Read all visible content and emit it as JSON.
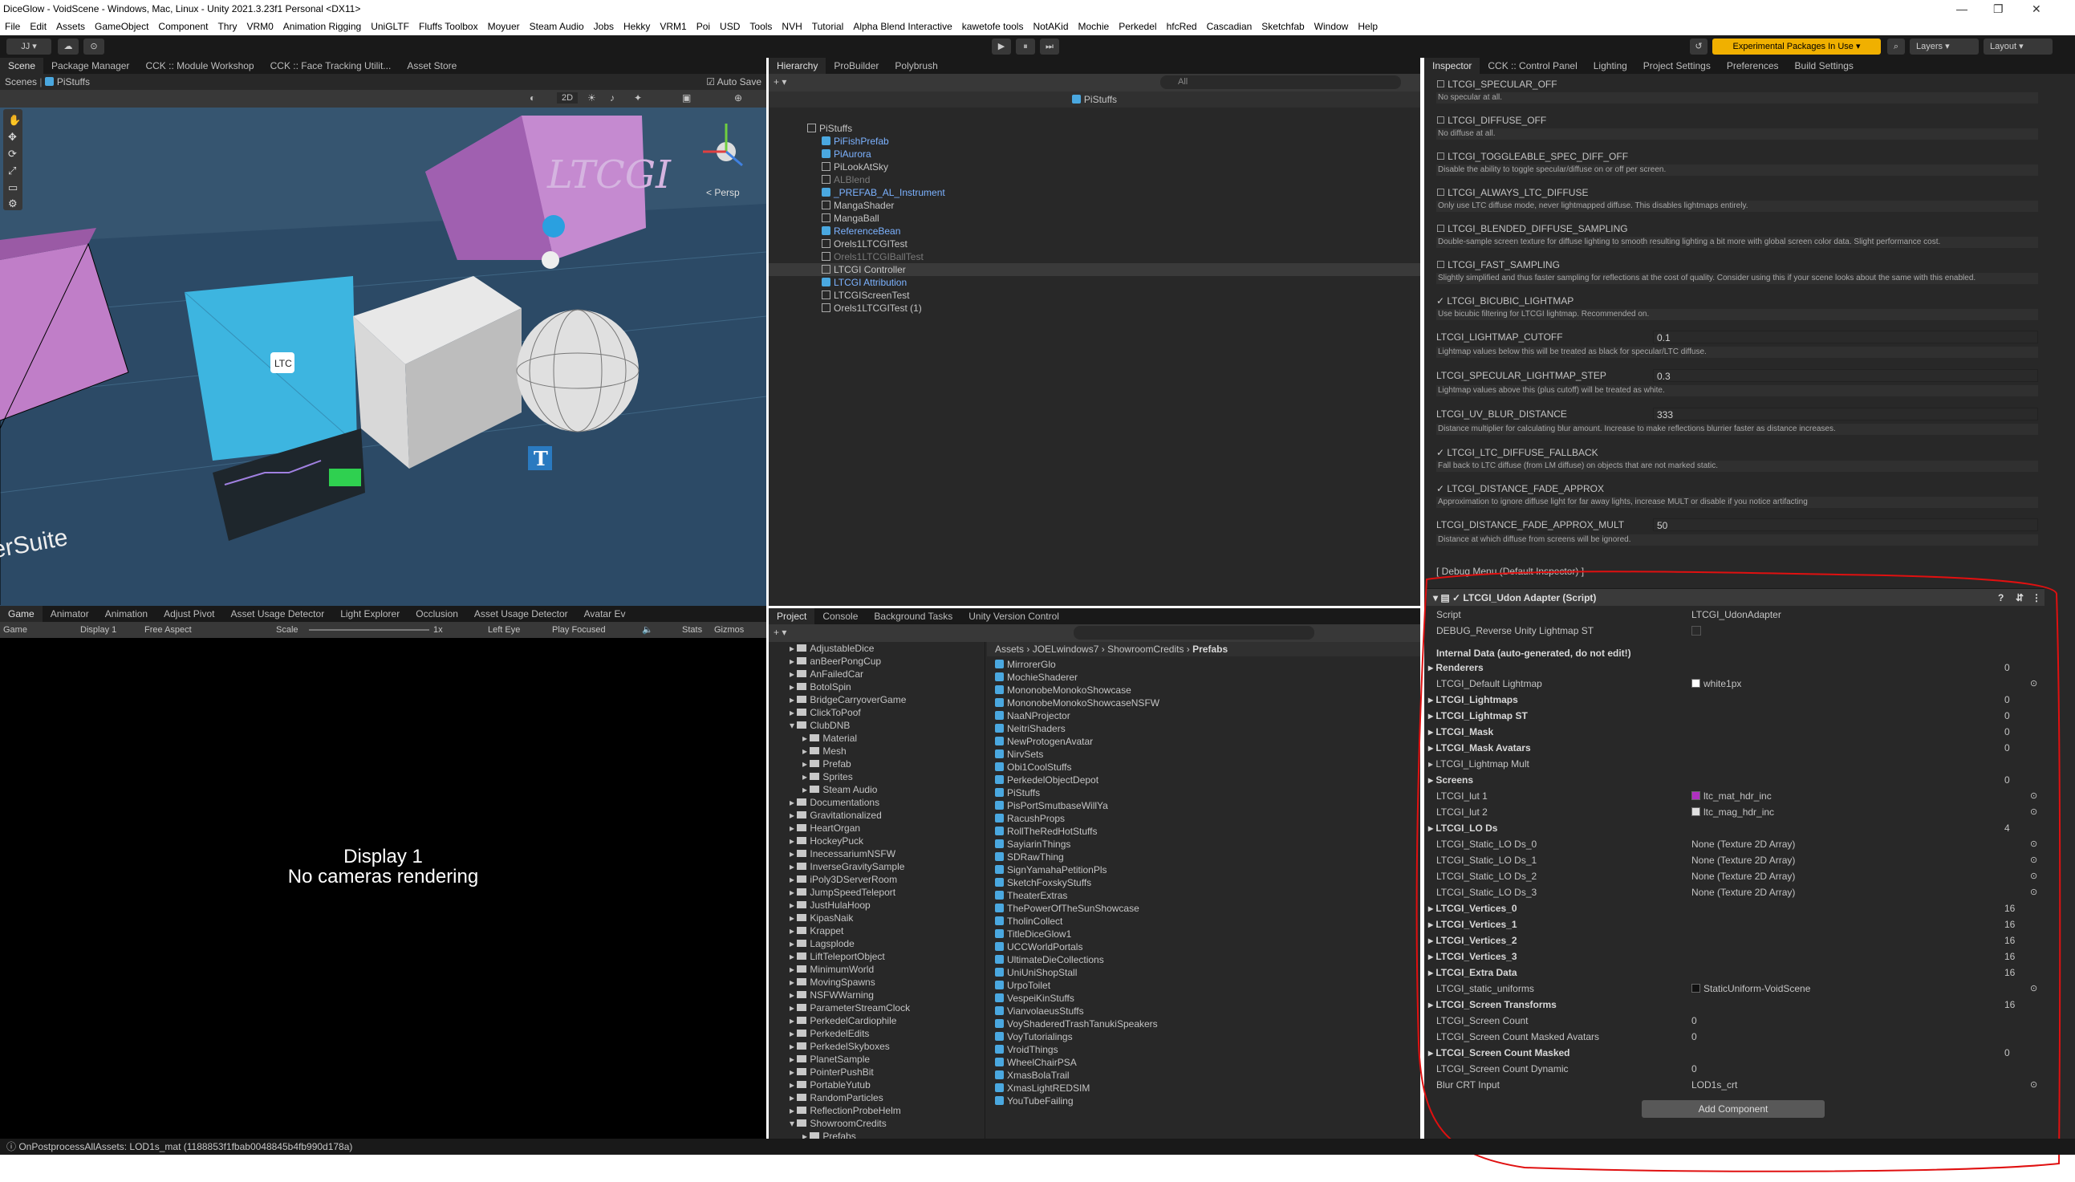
{
  "window": {
    "title": "DiceGlow - VoidScene - Windows, Mac, Linux - Unity 2021.3.23f1 Personal <DX11>",
    "minimize": "—",
    "maximize": "❐",
    "close": "✕"
  },
  "menu": [
    "File",
    "Edit",
    "Assets",
    "GameObject",
    "Component",
    "Thry",
    "VRM0",
    "Animation Rigging",
    "UniGLTF",
    "Fluffs Toolbox",
    "Moyuer",
    "Steam Audio",
    "Jobs",
    "Hekky",
    "VRM1",
    "Poi",
    "USD",
    "Tools",
    "NVH",
    "Tutorial",
    "Alpha Blend Interactive",
    "kawetofe tools",
    "NotAKid",
    "Mochie",
    "Perkedel",
    "hfcRed",
    "Cascadian",
    "Sketchfab",
    "Window",
    "Help"
  ],
  "toolbar": {
    "account": "JJ ▾",
    "experimental": "Experimental Packages In Use ▾",
    "layers": "Layers",
    "layout": "Layout",
    "play": "▶",
    "pause": "⏸",
    "step": "⏭"
  },
  "scene": {
    "tabs": [
      "Scene",
      "Package Manager",
      "CCK :: Module Workshop",
      "CCK :: Face Tracking Utilit...",
      "Asset Store"
    ],
    "breadcrumb_scenes": "Scenes",
    "breadcrumb_obj": "PiStuffs",
    "autosave": "Auto Save",
    "persp": "< Persp",
    "mode2d": "2D",
    "ltc_label": "LTC",
    "suite_text": "erSuite",
    "ltcgi_text": "LTCGI"
  },
  "game": {
    "tabs": [
      "Game",
      "Animator",
      "Animation",
      "Adjust Pivot",
      "Asset Usage Detector",
      "Light Explorer",
      "Occlusion",
      "Asset Usage Detector",
      "Avatar Ev"
    ],
    "game_label": "Game",
    "display": "Display 1",
    "aspect": "Free Aspect",
    "scale_label": "Scale",
    "scale_val": "1x",
    "eye": "Left Eye",
    "play_focused": "Play Focused",
    "stats": "Stats",
    "gizmos": "Gizmos",
    "msg1": "Display 1",
    "msg2": "No cameras rendering"
  },
  "hierarchy": {
    "tabs": [
      "Hierarchy",
      "ProBuilder",
      "Polybrush"
    ],
    "search": "All",
    "root": "PiStuffs",
    "items": [
      {
        "label": "PiStuffs",
        "kind": "go",
        "indent": 0,
        "color": "normal"
      },
      {
        "label": "PiFishPrefab",
        "kind": "prefab",
        "indent": 1,
        "color": "blue"
      },
      {
        "label": "PiAurora",
        "kind": "prefab",
        "indent": 1,
        "color": "blue"
      },
      {
        "label": "PiLookAtSky",
        "kind": "go",
        "indent": 1,
        "color": "normal"
      },
      {
        "label": "ALBlend",
        "kind": "go",
        "indent": 1,
        "color": "dim"
      },
      {
        "label": "_PREFAB_AL_Instrument",
        "kind": "prefab",
        "indent": 1,
        "color": "blue"
      },
      {
        "label": "MangaShader",
        "kind": "go",
        "indent": 1,
        "color": "normal"
      },
      {
        "label": "MangaBall",
        "kind": "go",
        "indent": 1,
        "color": "normal"
      },
      {
        "label": "ReferenceBean",
        "kind": "prefab",
        "indent": 1,
        "color": "blue"
      },
      {
        "label": "Orels1LTCGITest",
        "kind": "go",
        "indent": 1,
        "color": "normal"
      },
      {
        "label": "Orels1LTCGIBallTest",
        "kind": "go",
        "indent": 1,
        "color": "dim"
      },
      {
        "label": "LTCGI Controller",
        "kind": "go",
        "indent": 1,
        "color": "normal"
      },
      {
        "label": "LTCGI Attribution",
        "kind": "prefab",
        "indent": 1,
        "color": "blue"
      },
      {
        "label": "LTCGIScreenTest",
        "kind": "go",
        "indent": 1,
        "color": "normal"
      },
      {
        "label": "Orels1LTCGITest (1)",
        "kind": "go",
        "indent": 1,
        "color": "normal"
      }
    ]
  },
  "project": {
    "tabs": [
      "Project",
      "Console",
      "Background Tasks",
      "Unity Version Control"
    ],
    "breadcrumb": [
      "Assets",
      "JOELwindows7",
      "ShowroomCredits",
      "Prefabs"
    ],
    "folders": [
      {
        "label": "AdjustableDice",
        "indent": 1
      },
      {
        "label": "anBeerPongCup",
        "indent": 1
      },
      {
        "label": "AnFailedCar",
        "indent": 1
      },
      {
        "label": "BotolSpin",
        "indent": 1
      },
      {
        "label": "BridgeCarryoverGame",
        "indent": 1
      },
      {
        "label": "ClickToPoof",
        "indent": 1
      },
      {
        "label": "ClubDNB",
        "indent": 1
      },
      {
        "label": "Material",
        "indent": 2
      },
      {
        "label": "Mesh",
        "indent": 2
      },
      {
        "label": "Prefab",
        "indent": 2
      },
      {
        "label": "Sprites",
        "indent": 2
      },
      {
        "label": "Steam Audio",
        "indent": 2
      },
      {
        "label": "Documentations",
        "indent": 1
      },
      {
        "label": "Gravitationalized",
        "indent": 1
      },
      {
        "label": "HeartOrgan",
        "indent": 1
      },
      {
        "label": "HockeyPuck",
        "indent": 1
      },
      {
        "label": "InecessariumNSFW",
        "indent": 1
      },
      {
        "label": "InverseGravitySample",
        "indent": 1
      },
      {
        "label": "iPoly3DServerRoom",
        "indent": 1
      },
      {
        "label": "JumpSpeedTeleport",
        "indent": 1
      },
      {
        "label": "JustHulaHoop",
        "indent": 1
      },
      {
        "label": "KipasNaik",
        "indent": 1
      },
      {
        "label": "Krappet",
        "indent": 1
      },
      {
        "label": "Lagsplode",
        "indent": 1
      },
      {
        "label": "LiftTeleportObject",
        "indent": 1
      },
      {
        "label": "MinimumWorld",
        "indent": 1
      },
      {
        "label": "MovingSpawns",
        "indent": 1
      },
      {
        "label": "NSFWWarning",
        "indent": 1
      },
      {
        "label": "ParameterStreamClock",
        "indent": 1
      },
      {
        "label": "PerkedelCardiophile",
        "indent": 1
      },
      {
        "label": "PerkedelEdits",
        "indent": 1
      },
      {
        "label": "PerkedelSkyboxes",
        "indent": 1
      },
      {
        "label": "PlanetSample",
        "indent": 1
      },
      {
        "label": "PointerPushBit",
        "indent": 1
      },
      {
        "label": "PortableYutub",
        "indent": 1
      },
      {
        "label": "RandomParticles",
        "indent": 1
      },
      {
        "label": "ReflectionProbeHelm",
        "indent": 1
      },
      {
        "label": "ShowroomCredits",
        "indent": 1
      },
      {
        "label": "Prefabs",
        "indent": 2
      }
    ],
    "assets": [
      "MirrorerGlo",
      "MochieShaderer",
      "MononobeMonokoShowcase",
      "MononobeMonokoShowcaseNSFW",
      "NaaNProjector",
      "NeitriShaders",
      "NewProtogenAvatar",
      "NirvSets",
      "Obi1CoolStuffs",
      "PerkedelObjectDepot",
      "PiStuffs",
      "PisPortSmutbaseWillYa",
      "RacushProps",
      "RollTheRedHotStuffs",
      "SayiarinThings",
      "SDRawThing",
      "SignYamahaPetitionPls",
      "SketchFoxskyStuffs",
      "TheaterExtras",
      "ThePowerOfTheSunShowcase",
      "TholinCollect",
      "TitleDiceGlow1",
      "UCCWorldPortals",
      "UltimateDieCollections",
      "UniUniShopStall",
      "UrpoToilet",
      "VespeiKinStuffs",
      "VianvolaeusStuffs",
      "VoyShaderedTrashTanukiSpeakers",
      "VoyTutorialings",
      "VroidThings",
      "WheelChairPSA",
      "XmasBolaTrail",
      "XmasLightREDSIM",
      "YouTubeFailing"
    ]
  },
  "inspector": {
    "tabs": [
      "Inspector",
      "CCK :: Control Panel",
      "Lighting",
      "Project Settings",
      "Preferences",
      "Build Settings"
    ],
    "toggles": [
      {
        "label": "LTCGI_SPECULAR_OFF",
        "desc": "No specular at all.",
        "checked": false
      },
      {
        "label": "LTCGI_DIFFUSE_OFF",
        "desc": "No diffuse at all.",
        "checked": false
      },
      {
        "label": "LTCGI_TOGGLEABLE_SPEC_DIFF_OFF",
        "desc": "Disable the ability to toggle specular/diffuse on or off per screen.",
        "checked": false
      },
      {
        "label": "LTCGI_ALWAYS_LTC_DIFFUSE",
        "desc": "Only use LTC diffuse mode, never lightmapped diffuse. This disables lightmaps entirely.",
        "checked": false
      },
      {
        "label": "LTCGI_BLENDED_DIFFUSE_SAMPLING",
        "desc": "Double-sample screen texture for diffuse lighting to smooth resulting lighting a bit more with global screen color data. Slight performance cost.",
        "checked": false
      },
      {
        "label": "LTCGI_FAST_SAMPLING",
        "desc": "Slightly simplified and thus faster sampling for reflections at the cost of quality. Consider using this if your scene looks about the same with this enabled.",
        "checked": false
      },
      {
        "label": "LTCGI_BICUBIC_LIGHTMAP",
        "desc": "Use bicubic filtering for LTCGI lightmap. Recommended on.",
        "checked": true
      }
    ],
    "values": [
      {
        "label": "LTCGI_LIGHTMAP_CUTOFF",
        "value": "0.1",
        "desc": "Lightmap values below this will be treated as black for specular/LTC diffuse."
      },
      {
        "label": "LTCGI_SPECULAR_LIGHTMAP_STEP",
        "value": "0.3",
        "desc": "Lightmap values above this (plus cutoff) will be treated as white."
      },
      {
        "label": "LTCGI_UV_BLUR_DISTANCE",
        "value": "333",
        "desc": "Distance multiplier for calculating blur amount. Increase to make reflections blurrier faster as distance increases."
      }
    ],
    "toggles2": [
      {
        "label": "LTCGI_LTC_DIFFUSE_FALLBACK",
        "desc": "Fall back to LTC diffuse (from LM diffuse) on objects that are not marked static.",
        "checked": true
      },
      {
        "label": "LTCGI_DISTANCE_FADE_APPROX",
        "desc": "Approximation to ignore diffuse light for far away lights, increase MULT or disable if you notice artifacting",
        "checked": true
      }
    ],
    "fade_mult": {
      "label": "LTCGI_DISTANCE_FADE_APPROX_MULT",
      "value": "50",
      "desc": "Distance at which diffuse from screens will be ignored."
    },
    "debug_menu": "[ Debug Menu (Default Inspector) ]",
    "component_title": "LTCGI_Udon Adapter (Script)",
    "script_label": "Script",
    "script_value": "LTCGI_UdonAdapter",
    "debug_reverse": "DEBUG_Reverse Unity Lightmap ST",
    "internal_header": "Internal Data (auto-generated, do not edit!)",
    "rows": [
      {
        "label": "Renderers",
        "value": "0",
        "kind": "num",
        "bold": true,
        "fold": true
      },
      {
        "label": "LTCGI_Default Lightmap",
        "value": "white1px",
        "kind": "obj",
        "bold": false,
        "fold": false,
        "swatch": "#ffffff"
      },
      {
        "label": "LTCGI_Lightmaps",
        "value": "0",
        "kind": "num",
        "bold": true,
        "fold": true
      },
      {
        "label": "LTCGI_Lightmap ST",
        "value": "0",
        "kind": "num",
        "bold": true,
        "fold": true
      },
      {
        "label": "LTCGI_Mask",
        "value": "0",
        "kind": "num",
        "bold": true,
        "fold": true
      },
      {
        "label": "LTCGI_Mask Avatars",
        "value": "0",
        "kind": "num",
        "bold": true,
        "fold": true
      },
      {
        "label": "LTCGI_Lightmap Mult",
        "value": "",
        "kind": "none",
        "bold": false,
        "fold": true
      },
      {
        "label": "Screens",
        "value": "0",
        "kind": "num",
        "bold": true,
        "fold": true
      },
      {
        "label": "LTCGI_lut 1",
        "value": "ltc_mat_hdr_inc",
        "kind": "obj",
        "bold": false,
        "fold": false,
        "swatch": "#b030c0"
      },
      {
        "label": "LTCGI_lut 2",
        "value": "ltc_mag_hdr_inc",
        "kind": "obj",
        "bold": false,
        "fold": false,
        "swatch": "#e0e0e0"
      },
      {
        "label": "LTCGI_LO Ds",
        "value": "4",
        "kind": "num",
        "bold": true,
        "fold": true
      },
      {
        "label": "LTCGI_Static_LO Ds_0",
        "value": "None (Texture 2D Array)",
        "kind": "obj",
        "bold": false,
        "fold": false
      },
      {
        "label": "LTCGI_Static_LO Ds_1",
        "value": "None (Texture 2D Array)",
        "kind": "obj",
        "bold": false,
        "fold": false
      },
      {
        "label": "LTCGI_Static_LO Ds_2",
        "value": "None (Texture 2D Array)",
        "kind": "obj",
        "bold": false,
        "fold": false
      },
      {
        "label": "LTCGI_Static_LO Ds_3",
        "value": "None (Texture 2D Array)",
        "kind": "obj",
        "bold": false,
        "fold": false
      },
      {
        "label": "LTCGI_Vertices_0",
        "value": "16",
        "kind": "num",
        "bold": true,
        "fold": true
      },
      {
        "label": "LTCGI_Vertices_1",
        "value": "16",
        "kind": "num",
        "bold": true,
        "fold": true
      },
      {
        "label": "LTCGI_Vertices_2",
        "value": "16",
        "kind": "num",
        "bold": true,
        "fold": true
      },
      {
        "label": "LTCGI_Vertices_3",
        "value": "16",
        "kind": "num",
        "bold": true,
        "fold": true
      },
      {
        "label": "LTCGI_Extra Data",
        "value": "16",
        "kind": "num",
        "bold": true,
        "fold": true
      },
      {
        "label": "LTCGI_static_uniforms",
        "value": "StaticUniform-VoidScene",
        "kind": "obj",
        "bold": false,
        "fold": false,
        "swatch": "#111111"
      },
      {
        "label": "LTCGI_Screen Transforms",
        "value": "16",
        "kind": "num",
        "bold": true,
        "fold": true
      },
      {
        "label": "LTCGI_Screen Count",
        "value": "0",
        "kind": "text",
        "bold": false,
        "fold": false
      },
      {
        "label": "LTCGI_Screen Count Masked Avatars",
        "value": "0",
        "kind": "text",
        "bold": false,
        "fold": false
      },
      {
        "label": "LTCGI_Screen Count Masked",
        "value": "0",
        "kind": "num",
        "bold": true,
        "fold": true
      },
      {
        "label": "LTCGI_Screen Count Dynamic",
        "value": "0",
        "kind": "text",
        "bold": false,
        "fold": false
      },
      {
        "label": "Blur CRT Input",
        "value": "LOD1s_crt",
        "kind": "obj",
        "bold": false,
        "fold": false
      }
    ],
    "add_component": "Add Component"
  },
  "status": "OnPostprocessAllAssets: LOD1s_mat (1188853f1fbab0048845b4fb990d178a)",
  "colors": {
    "annotation": "#e01010",
    "accent": "#4aa8e0",
    "experimental": "#f0b000"
  }
}
